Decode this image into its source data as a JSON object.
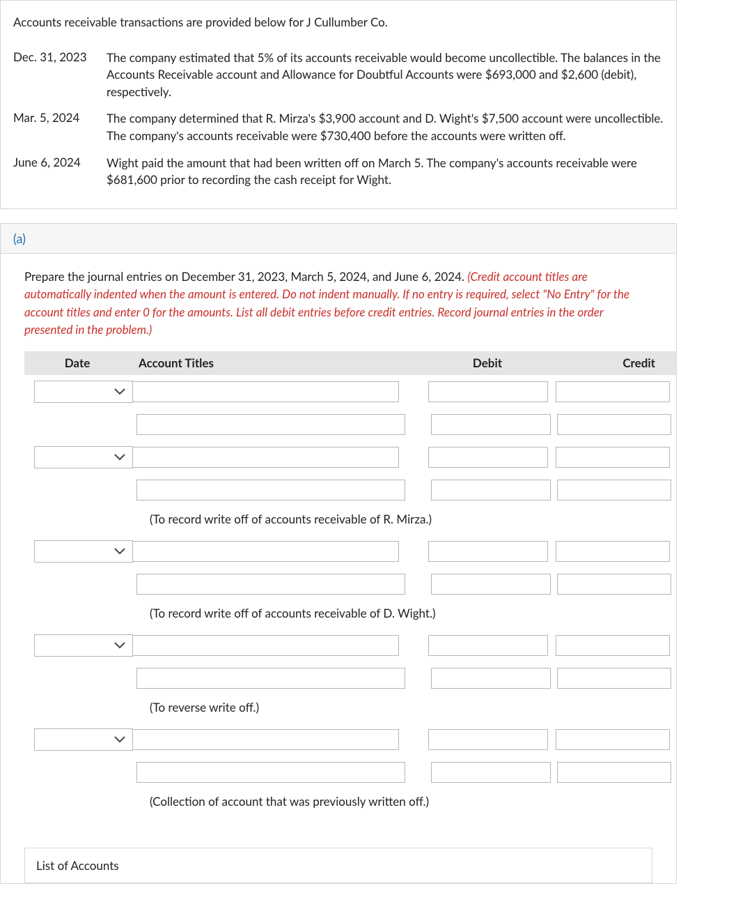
{
  "intro": "Accounts receivable transactions are provided below for J Cullumber Co.",
  "transactions": [
    {
      "date": "Dec. 31, 2023",
      "desc": "The company estimated that 5% of its accounts receivable would become uncollectible. The balances in the Accounts Receivable account and Allowance for Doubtful Accounts were $693,000 and $2,600 (debit), respectively."
    },
    {
      "date": "Mar. 5, 2024",
      "desc": "The company determined that R. Mirza's $3,900 account and D. Wight's $7,500 account were uncollectible. The company's accounts receivable were $730,400 before the accounts were written off."
    },
    {
      "date": "June 6, 2024",
      "desc": "Wight paid the amount that had been written off on March 5. The company's accounts receivable were $681,600 prior to recording the cash receipt for Wight."
    }
  ],
  "part_label": "(a)",
  "instruction_plain": "Prepare the journal entries on December 31, 2023, March 5, 2024, and June 6, 2024. ",
  "instruction_note": "(Credit account titles are automatically indented when the amount is entered. Do not indent manually. If no entry is required, select \"No Entry\" for the account titles and enter 0 for the amounts. List all debit entries before credit entries. Record journal entries in the order presented in the problem.)",
  "headers": {
    "date": "Date",
    "titles": "Account Titles",
    "debit": "Debit",
    "credit": "Credit"
  },
  "explanations": {
    "e1": "(To record write off of accounts receivable of R. Mirza.)",
    "e2": "(To record write off of accounts receivable of D. Wight.)",
    "e3": "(To reverse write off.)",
    "e4": "(Collection of account that was previously written off.)"
  },
  "list_of_accounts": "List of Accounts"
}
